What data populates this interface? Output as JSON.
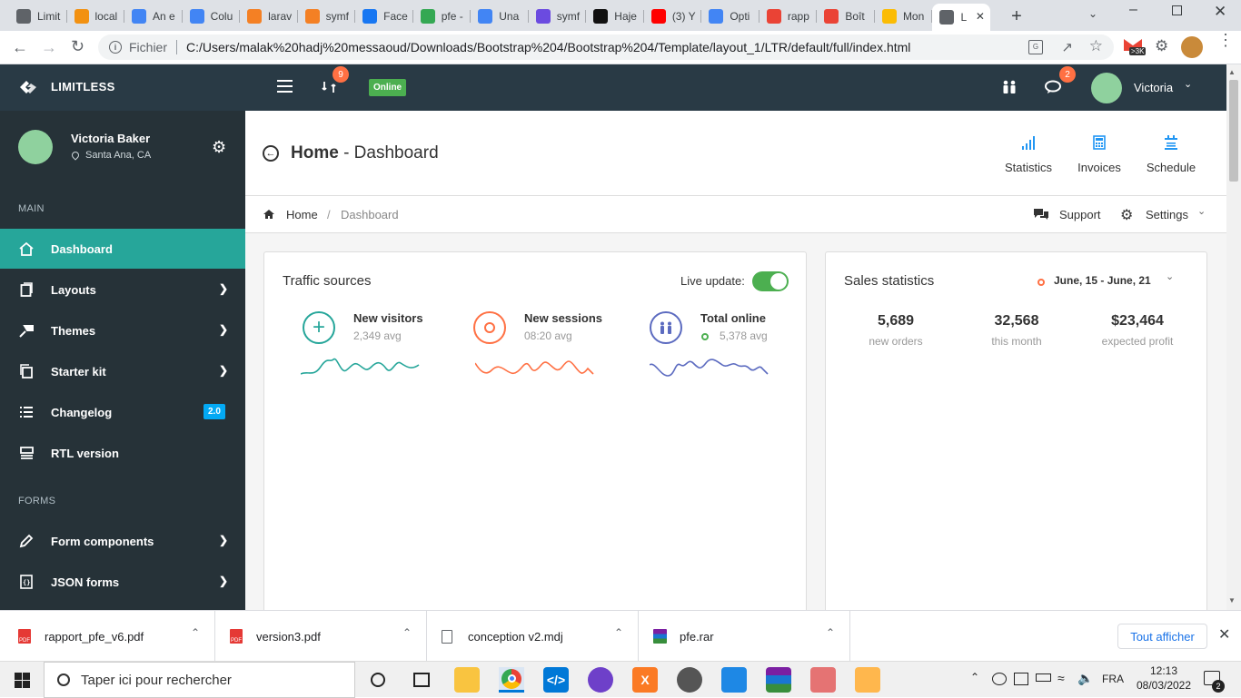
{
  "browser": {
    "tabs": [
      {
        "label": "Limit",
        "icon": "globe-icon",
        "color": "#5f6368"
      },
      {
        "label": "local",
        "icon": "phpmyadmin-icon",
        "color": "#f29111"
      },
      {
        "label": "An e",
        "icon": "google-icon",
        "color": "#4285f4"
      },
      {
        "label": "Colu",
        "icon": "google-icon",
        "color": "#4285f4"
      },
      {
        "label": "larav",
        "icon": "stackoverflow-icon",
        "color": "#f48024"
      },
      {
        "label": "symf",
        "icon": "stackoverflow-icon",
        "color": "#f48024"
      },
      {
        "label": "Face",
        "icon": "facebook-icon",
        "color": "#1877f2"
      },
      {
        "label": "pfe -",
        "icon": "drive-icon",
        "color": "#34a853"
      },
      {
        "label": "Una",
        "icon": "google-icon",
        "color": "#4285f4"
      },
      {
        "label": "symf",
        "icon": "symfonycasts-icon",
        "color": "#6b4be0"
      },
      {
        "label": "Haje",
        "icon": "github-icon",
        "color": "#111111"
      },
      {
        "label": "(3) Y",
        "icon": "youtube-icon",
        "color": "#ff0000"
      },
      {
        "label": "Opti",
        "icon": "google-icon",
        "color": "#4285f4"
      },
      {
        "label": "rapp",
        "icon": "gmail-icon",
        "color": "#ea4335"
      },
      {
        "label": "Boît",
        "icon": "gmail-icon",
        "color": "#ea4335"
      },
      {
        "label": "Mon",
        "icon": "drive-icon",
        "color": "#fbbc04"
      },
      {
        "label": "L",
        "icon": "globe-icon",
        "color": "#5f6368",
        "active": true
      }
    ],
    "url_prefix": "Fichier",
    "url": "C:/Users/malak%20hadj%20messaoud/Downloads/Bootstrap%204/Bootstrap%204/Template/layout_1/LTR/default/full/index.html",
    "gmail_badge": ">3K"
  },
  "navbar": {
    "brand": "LIMITLESS",
    "git_badge": "9",
    "status_badge": "Online",
    "chat_badge": "2",
    "user_name": "Victoria"
  },
  "sidebar": {
    "user_name": "Victoria Baker",
    "user_location": "Santa Ana, CA",
    "section_main": "MAIN",
    "section_forms": "FORMS",
    "items": [
      {
        "label": "Dashboard",
        "icon": "home-icon",
        "active": true
      },
      {
        "label": "Layouts",
        "icon": "copy-icon"
      },
      {
        "label": "Themes",
        "icon": "paint-icon"
      },
      {
        "label": "Starter kit",
        "icon": "stack-icon"
      },
      {
        "label": "Changelog",
        "icon": "list-icon",
        "badge": "2.0"
      },
      {
        "label": "RTL version",
        "icon": "rtl-icon"
      },
      {
        "label": "Form components",
        "icon": "pencil-icon"
      },
      {
        "label": "JSON forms",
        "icon": "json-icon"
      }
    ]
  },
  "page": {
    "title_main": "Home",
    "title_sub": " - Dashboard",
    "header_actions": [
      {
        "label": "Statistics",
        "icon": "bar-chart-icon"
      },
      {
        "label": "Invoices",
        "icon": "calculator-icon"
      },
      {
        "label": "Schedule",
        "icon": "calendar-list-icon"
      }
    ],
    "breadcrumb": {
      "home": "Home",
      "separator": "/",
      "current": "Dashboard"
    },
    "support_label": "Support",
    "settings_label": "Settings"
  },
  "traffic": {
    "title": "Traffic sources",
    "live_label": "Live update:",
    "live_on": true,
    "stats": [
      {
        "label": "New visitors",
        "value": "2,349 avg",
        "icon": "plus-circle-icon",
        "color": "#26a69a"
      },
      {
        "label": "New sessions",
        "value": "08:20 avg",
        "icon": "watch-icon",
        "color": "#ff7043"
      },
      {
        "label": "Total online",
        "value": "5,378 avg",
        "icon": "people-icon",
        "color": "#5c6bc0"
      }
    ]
  },
  "sales": {
    "title": "Sales statistics",
    "date_range": "June, 15 - June, 21",
    "stats": [
      {
        "value": "5,689",
        "label": "new orders"
      },
      {
        "value": "32,568",
        "label": "this month"
      },
      {
        "value": "$23,464",
        "label": "expected profit"
      }
    ]
  },
  "downloads": {
    "files": [
      {
        "name": "rapport_pfe_v6.pdf",
        "icon": "pdf-icon"
      },
      {
        "name": "version3.pdf",
        "icon": "pdf-icon"
      },
      {
        "name": "conception v2.mdj",
        "icon": "file-icon"
      },
      {
        "name": "pfe.rar",
        "icon": "rar-icon"
      }
    ],
    "show_all": "Tout afficher"
  },
  "taskbar": {
    "search_placeholder": "Taper ici pour rechercher",
    "lang": "FRA",
    "time": "12:13",
    "date": "08/03/2022",
    "notif_count": "2"
  }
}
